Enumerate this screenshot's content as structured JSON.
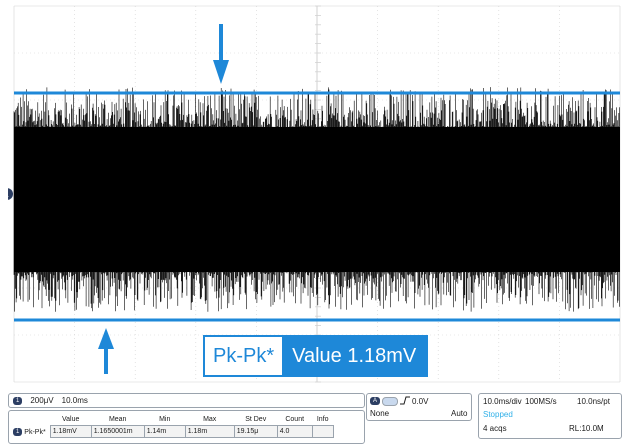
{
  "callout": {
    "label": "Pk-Pk*",
    "value": "Value 1.18mV"
  },
  "colors": {
    "accent": "#1e88d8",
    "trace": "#000000",
    "grid": "#d2d2d2",
    "stopped": "#30b0e8"
  },
  "channel": {
    "badge": "1",
    "scale": "200μV",
    "timebase": "10.0ms"
  },
  "measurements": {
    "headers": [
      "Value",
      "Mean",
      "Min",
      "Max",
      "St Dev",
      "Count",
      "Info"
    ],
    "rows": [
      {
        "badge": "1",
        "label": "Pk-Pk*",
        "cells": [
          "1.18mV",
          "1.1650001m",
          "1.14m",
          "1.18m",
          "19.15μ",
          "4.0",
          ""
        ]
      }
    ]
  },
  "trigger": {
    "source_badge": "A",
    "slope_icon": "rising-edge-icon",
    "level": "0.0V",
    "coupling": "None",
    "mode": "Auto"
  },
  "acquisition": {
    "horizontal": "10.0ms/div",
    "sample_rate": "100MS/s",
    "resolution": "10.0ns/pt",
    "state": "Stopped",
    "acqs": "4 acqs",
    "record_length": "RL:10.0M"
  },
  "cursors": {
    "ground_marker": "1"
  }
}
